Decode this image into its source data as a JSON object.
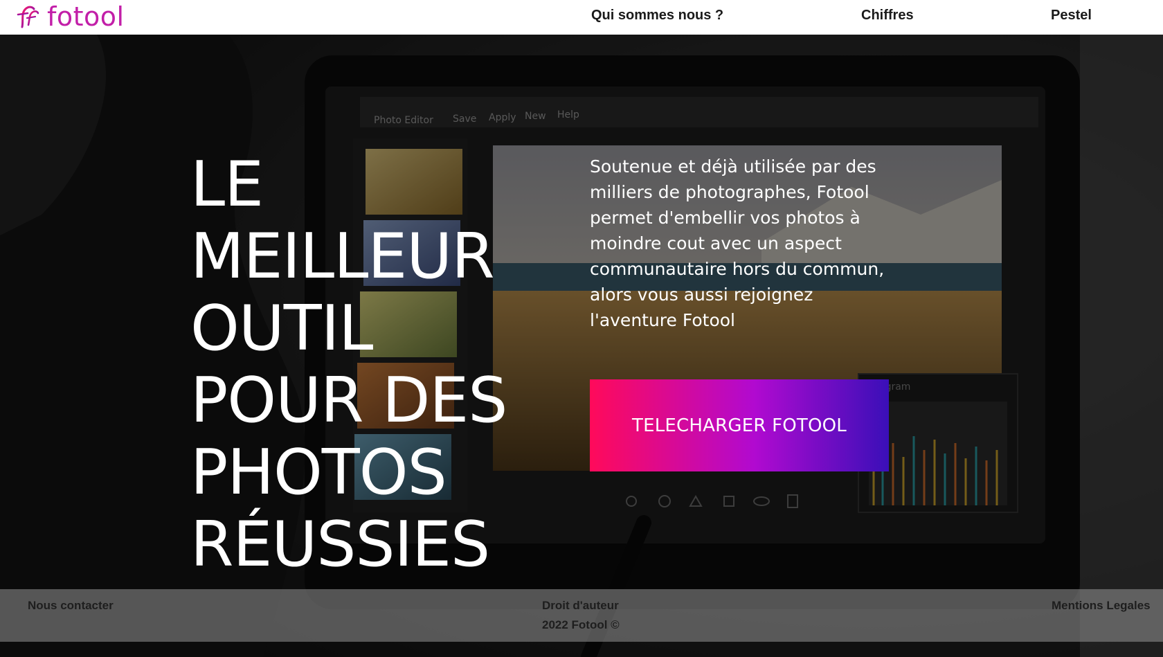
{
  "brand": {
    "name": "fotool",
    "colors": {
      "primary": "#c21fa8",
      "gradient_start": "#ff0a5a",
      "gradient_mid": "#b10ad0",
      "gradient_end": "#3a0fb8"
    }
  },
  "nav": {
    "items": [
      {
        "label": "Qui sommes nous ?"
      },
      {
        "label": "Chiffres"
      },
      {
        "label": "Pestel"
      }
    ]
  },
  "hero": {
    "headline_lines": [
      "LE",
      "MEILLEUR",
      "OUTIL",
      "POUR DES",
      "PHOTOS",
      "RÉUSSIES"
    ],
    "description": "Soutenue et déjà utilisée par des milliers de photographes, Fotool permet d'embellir vos photos à moindre cout avec un aspect communautaire hors du commun, alors vous aussi rejoignez l'aventure Fotool",
    "cta_label": "TELECHARGER FOTOOL"
  },
  "background_screen": {
    "menu": [
      "Photo Editor",
      "Save",
      "Apply",
      "New",
      "Help"
    ],
    "panel_label": "ogram"
  },
  "footer": {
    "contact_label": "Nous contacter",
    "copyright_title": "Droit d'auteur",
    "copyright_text": "2022 Fotool ©",
    "legal_label": "Mentions Legales"
  }
}
